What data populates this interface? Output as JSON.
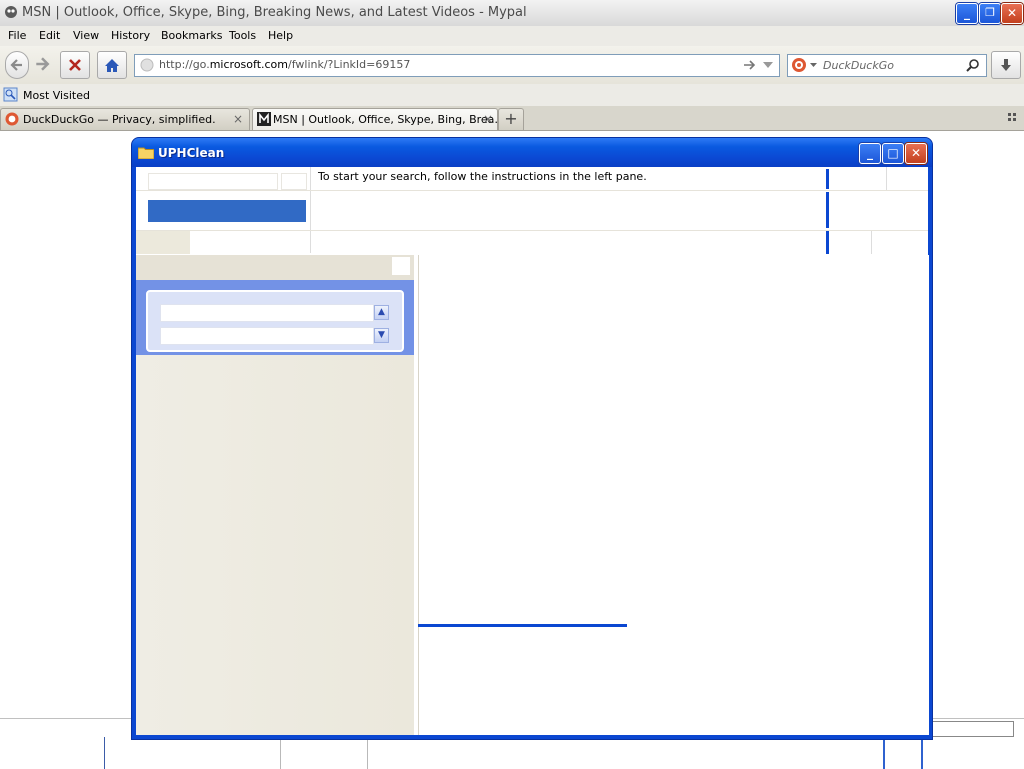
{
  "browser": {
    "window_title": "MSN | Outlook, Office, Skype, Bing, Breaking News, and Latest Videos - Mypal",
    "title_buttons": {
      "minimize": "_",
      "restore": "❐",
      "close": "✕"
    },
    "menu": [
      "File",
      "Edit",
      "View",
      "History",
      "Bookmarks",
      "Tools",
      "Help"
    ],
    "url": {
      "prefix": "http://go.",
      "domain": "microsoft.com",
      "path": "/fwlink/?LinkId=69157"
    },
    "search_placeholder": "DuckDuckGo",
    "bookmarks": [
      {
        "label": "Most Visited",
        "icon": "most-visited-icon"
      }
    ],
    "tabs": [
      {
        "title": "DuckDuckGo — Privacy, simplified.",
        "icon": "duckduckgo-icon",
        "active": false
      },
      {
        "title": "MSN | Outlook, Office, Skype, Bing, Brea…",
        "icon": "msn-icon",
        "active": true
      }
    ],
    "new_tab_symbol": "+",
    "tab_close_symbol": "×"
  },
  "uphclean": {
    "window_title": "UPHClean",
    "window_buttons": {
      "minimize": "_",
      "maximize": "□",
      "close": "✕"
    },
    "instructions": "To start your search, follow the instructions in the left pane."
  },
  "colors": {
    "xp_blue": "#0b47d1",
    "selection": "#316ac5",
    "pane_accent": "#7392e6"
  }
}
